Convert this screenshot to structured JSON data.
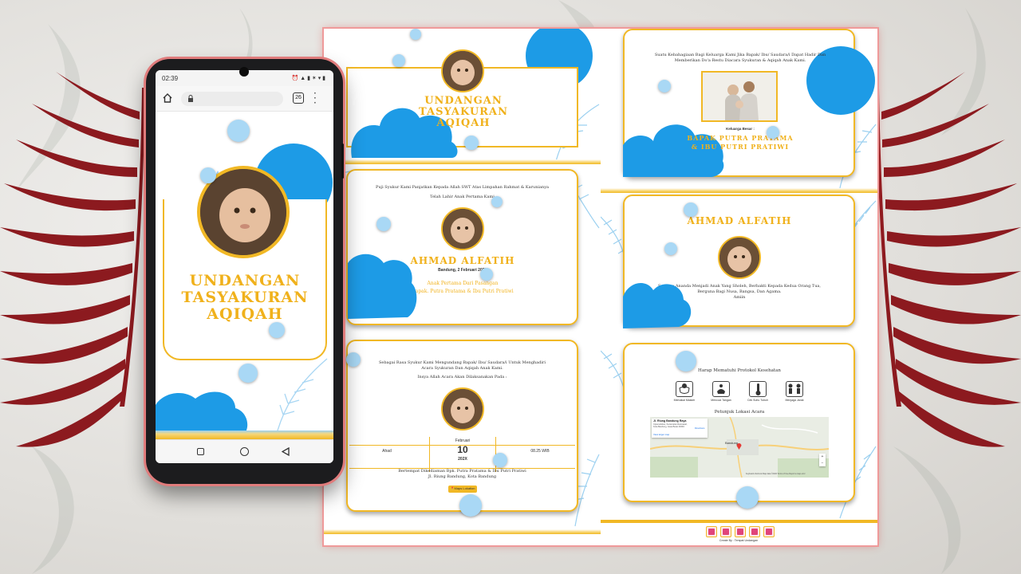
{
  "phone": {
    "status_time": "02:39",
    "status_icons": "⏰ ▲ ▮ ✶ ▾ ▮",
    "tabs_count": "26",
    "title_line1": "UNDANGAN",
    "title_line2": "TASYAKURAN",
    "title_line3": "AQIQAH"
  },
  "panel1": {
    "title_line1": "UNDANGAN",
    "title_line2": "TASYAKURAN",
    "title_line3": "AQIQAH"
  },
  "panel2": {
    "intro_line1": "Puji Syukur Kami Panjatkan Kepada Allah SWT Atas Limpahan Rahmat & Karunianya",
    "intro_line2": "Telah Lahir Anak Pertama Kami",
    "baby_name": "AHMAD ALFATIH",
    "birth_info": "Bandung, 2 Februari 202X",
    "child_of": "Anak Pertama Dari Pasangan",
    "parents": "Bapak. Putra Pratama & Ibu Putri Pratiwi"
  },
  "panel3": {
    "intro_line1": "Sebagai Rasa Syukur Kami Mengundang Bapak/ Ibu/ Saudara/i Untuk Menghadiri",
    "intro_line2": "Acara Syukuran Dan Aqiqah Anak Kami.",
    "intro_line3": "Insya Allah Acara Akan Dilaksanakan Pada :",
    "day": "Ahad",
    "month": "Februari",
    "date": "10",
    "year": "202X",
    "time": "08.25 WIB",
    "place_line1": "Bertempat Dikediaman Bpk. Putra Pratama & Ibu Putri Pratiwi",
    "place_line2": "Jl. Riung Bandung, Kota Bandung",
    "map_button": "Maps Lokation"
  },
  "panel4": {
    "intro_line1": "Suatu Kebahagiaan Bagi Keluarga Kami Jika Bapak/ Ibu/ Saudara/i Dapat Hadir Dan",
    "intro_line2": "Memberikan Do'a Restu Diacara Syukuran & Aqiqah Anak Kami.",
    "family_label": "Keluarga Besar :",
    "family_line1": "BAPAK PUTRA PRATAMA",
    "family_line2": "& IBU PUTRI PRATIWI"
  },
  "panel5": {
    "baby_name": "AHMAD ALFATIH",
    "prayer_line1": "Semoga Ananda Menjadi Anak Yang Sholeh, Berbakti Kepada Kedua Orang Tua,",
    "prayer_line2": "Berguna Bagi Nusa, Bangsa, Dan Agama.",
    "prayer_line3": "Amiin"
  },
  "panel6": {
    "protocol_title": "Harap Mematuhi Protokol Kesehatan",
    "protocols": [
      "Memakai Masker",
      "Mencuci Tangan",
      "Cek Suhu Tubuh",
      "Menjaga Jarak"
    ],
    "map_title": "Petunjuk Lokasi Acara",
    "map_place": "Jl. Riung Bandung Raya",
    "map_address": "Cipamokolan, Kecamatan Rancasari, Kota Bandung, Jawa Barat 40294",
    "map_larger": "View larger map",
    "map_directions": "Directions",
    "map_city": "Bandung",
    "map_footer": "Keyboard shortcuts  Map data ©2022  Terms of Use  Report a map error",
    "credit": "Create By : Tempat Undangan"
  },
  "colors": {
    "gold": "#f1b21d",
    "blue": "#1d9be6",
    "light_blue": "#a9d8f5",
    "leaf_red": "#8c1a1f"
  },
  "icons": [
    "home-icon",
    "lock-icon",
    "tabs-icon",
    "menu-dots-icon",
    "mask-icon",
    "hand-wash-icon",
    "thermometer-icon",
    "distance-icon",
    "map-pin-icon",
    "music-icon"
  ]
}
